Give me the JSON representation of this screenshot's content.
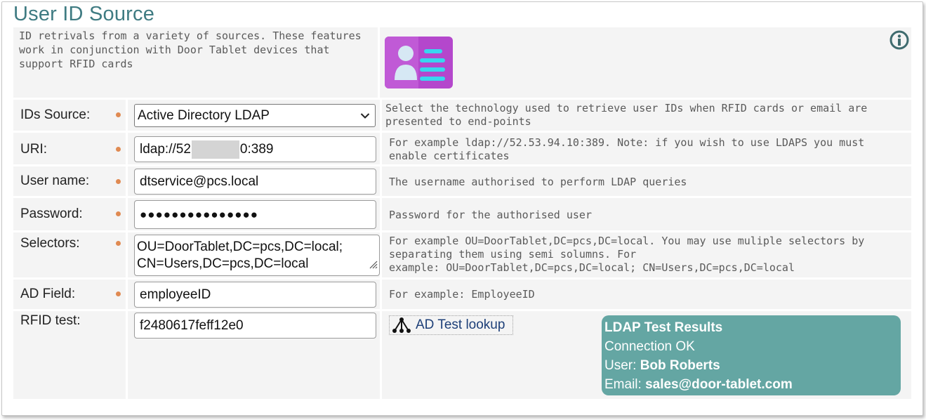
{
  "page": {
    "title": "User ID Source",
    "description": "ID retrivals from a variety of sources.  These features work in conjunction with Door Tablet devices that support RFID cards"
  },
  "icons": {
    "info": "info-circle-icon",
    "id_card": "user-id-card-icon",
    "network": "network-tree-icon",
    "chevron": "chevron-down-icon"
  },
  "colors": {
    "title": "#3f7b82",
    "required_dot": "#e08a52",
    "results_bg": "#64a6a3",
    "id_card_bg": "#b447cc",
    "link": "#1d3f78"
  },
  "form": {
    "ids_source": {
      "label": "IDs Source:",
      "value": "Active Directory LDAP",
      "help": "Select the technology used to retrieve user IDs when RFID cards or email are presented to end-points"
    },
    "uri": {
      "label": "URI:",
      "value_prefix": "ldap://52",
      "value_suffix": "0:389",
      "help": "For example ldap://52.53.94.10:389. Note: if you wish to use LDAPS you must enable certificates"
    },
    "username": {
      "label": "User name:",
      "value": "dtservice@pcs.local",
      "help": "The username authorised to perform LDAP queries"
    },
    "password": {
      "label": "Password:",
      "value": "●●●●●●●●●●●●●●●",
      "help": "Password for the authorised user"
    },
    "selectors": {
      "label": "Selectors:",
      "line1": "OU=DoorTablet,DC=pcs,DC=local;",
      "line2": "CN=Users,DC=pcs,DC=local",
      "help_line1": "For example OU=DoorTablet,DC=pcs,DC=local.  You may use muliple selectors by",
      "help_line2": "separating them using semi solumns.  For",
      "help_line3": "example: OU=DoorTablet,DC=pcs,DC=local; CN=Users,DC=pcs,DC=local"
    },
    "ad_field": {
      "label": "AD Field:",
      "value": "employeeID",
      "help": "For example: EmployeeID"
    },
    "rfid_test": {
      "label": "RFID test:",
      "value": "f2480617feff12e0",
      "lookup_label": "AD Test lookup"
    }
  },
  "results": {
    "title": "LDAP Test Results",
    "status": "Connection OK",
    "user_label": "User:",
    "user_value": "Bob Roberts",
    "email_label": "Email:",
    "email_value": "sales@door-tablet.com"
  }
}
